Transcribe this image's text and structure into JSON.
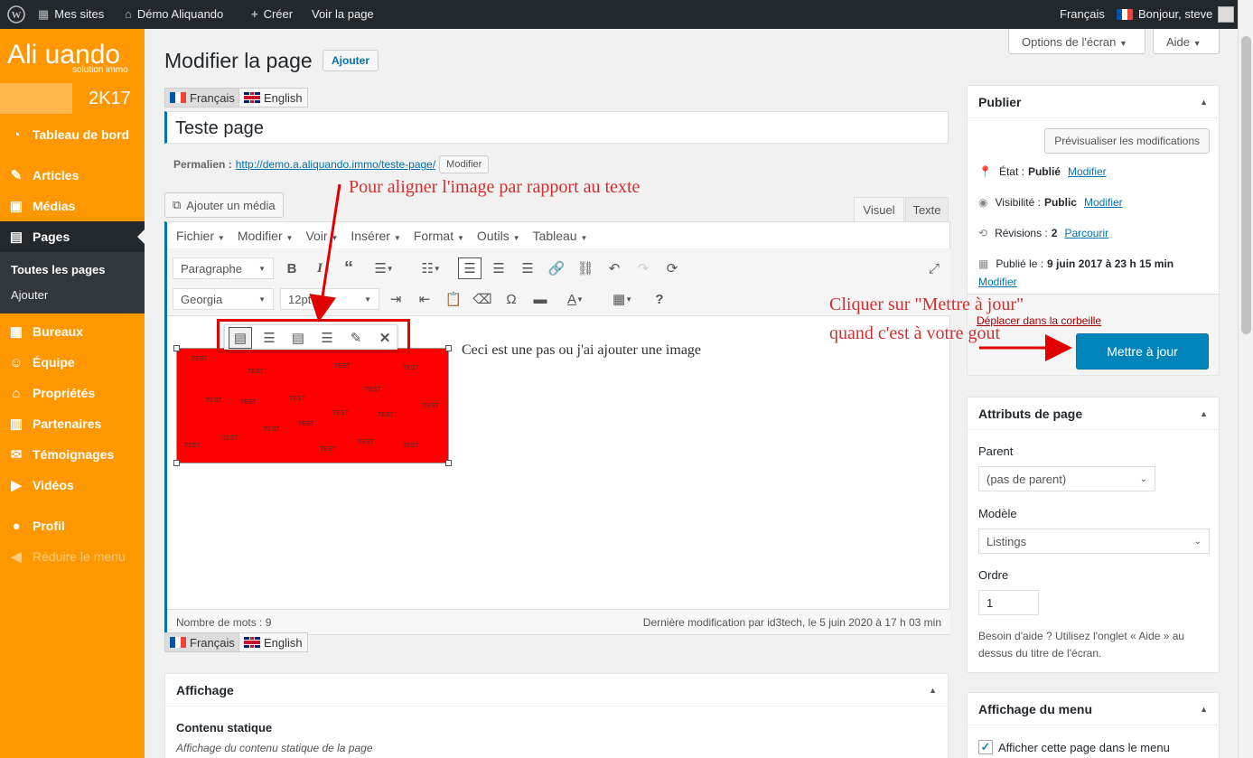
{
  "adminbar": {
    "my_sites": "Mes sites",
    "site_name": "Démo Aliquando",
    "create": "Créer",
    "view_page": "Voir la page",
    "language": "Français",
    "greeting": "Bonjour, steve"
  },
  "sidebar": {
    "logo": "Ali uando",
    "logo_sub": "solution immo",
    "year": "2K17",
    "items": [
      {
        "label": "Tableau de bord",
        "icon": "dashboard-icon"
      },
      {
        "label": "Articles",
        "icon": "pin-icon"
      },
      {
        "label": "Médias",
        "icon": "media-icon"
      },
      {
        "label": "Pages",
        "icon": "pages-icon"
      },
      {
        "label": "Bureaux",
        "icon": "building-icon"
      },
      {
        "label": "Équipe",
        "icon": "team-icon"
      },
      {
        "label": "Propriétés",
        "icon": "home-icon"
      },
      {
        "label": "Partenaires",
        "icon": "partners-icon"
      },
      {
        "label": "Témoignages",
        "icon": "testimonial-icon"
      },
      {
        "label": "Vidéos",
        "icon": "video-icon"
      },
      {
        "label": "Profil",
        "icon": "user-icon"
      },
      {
        "label": "Réduire le menu",
        "icon": "collapse-icon"
      }
    ],
    "submenu": [
      "Toutes les pages",
      "Ajouter"
    ]
  },
  "screen_options": "Options de l'écran",
  "help": "Aide",
  "page_title": "Modifier la page",
  "add_button": "Ajouter",
  "lang_fr": "Français",
  "lang_en": "English",
  "post_title": "Teste page",
  "permalink": {
    "label": "Permalien :",
    "url": "http://demo.a.aliquando.immo/teste-page/",
    "edit": "Modifier"
  },
  "add_media": "Ajouter un média",
  "editor_tabs": {
    "visual": "Visuel",
    "text": "Texte"
  },
  "menubar": [
    "Fichier",
    "Modifier",
    "Voir",
    "Insérer",
    "Format",
    "Outils",
    "Tableau"
  ],
  "format_select": "Paragraphe",
  "font_select": "Georgia",
  "size_select": "12pt",
  "image_label": "TEST",
  "content_text": "Ceci est une pas ou j'ai ajouter une image",
  "word_count": "Nombre de mots : 9",
  "last_modified": "Dernière modification par id3tech, le 5 juin 2020 à 17 h 03 min",
  "annotation_align": "Pour aligner l'image par rapport au texte",
  "annotation_update_1": "Cliquer sur \"Mettre à jour\"",
  "annotation_update_2": "quand c'est à votre gout",
  "publish": {
    "title": "Publier",
    "preview": "Prévisualiser les modifications",
    "status_label": "État :",
    "status_value": "Publié",
    "visibility_label": "Visibilité :",
    "visibility_value": "Public",
    "revisions_label": "Révisions :",
    "revisions_value": "2",
    "browse": "Parcourir",
    "published_label": "Publié le :",
    "published_value": "9 juin 2017 à 23 h 15 min",
    "edit": "Modifier",
    "trash": "Déplacer dans la corbeille",
    "update": "Mettre à jour"
  },
  "attributes": {
    "title": "Attributs de page",
    "parent_label": "Parent",
    "parent_value": "(pas de parent)",
    "template_label": "Modèle",
    "template_value": "Listings",
    "order_label": "Ordre",
    "order_value": "1",
    "help_text_1": "Besoin d'aide ? Utilisez l'onglet « Aide » au",
    "help_text_2": "dessus du titre de l'écran."
  },
  "menu_display": {
    "title": "Affichage du menu",
    "checkbox_label": "Afficher cette page dans le menu"
  },
  "display_box": {
    "title": "Affichage",
    "static_title": "Contenu statique",
    "static_desc": "Affichage du contenu statique de la page"
  },
  "colors": {
    "sidebar": "#ff9800",
    "adminbar": "#23282d",
    "primary": "#0085ba",
    "annotation": "#d32f2f",
    "image": "#ff0000"
  }
}
